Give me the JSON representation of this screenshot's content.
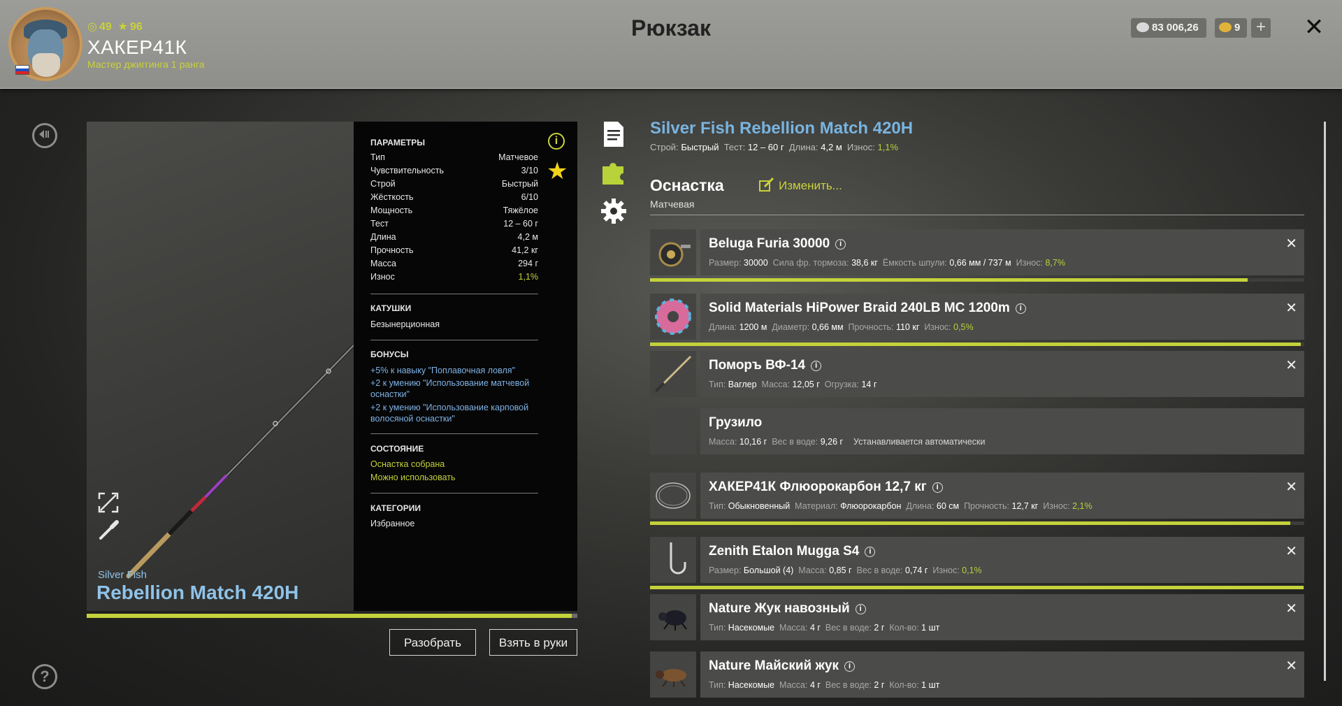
{
  "header": {
    "title": "Рюкзак",
    "player": {
      "level": "49",
      "stars": "96",
      "name": "ХАКЕР41К",
      "rank": "Мастер джиггинга 1 ранга"
    },
    "currency": {
      "silver": "83 006,26",
      "gold": "9"
    },
    "plus_label": "+",
    "close_label": "✕"
  },
  "rod": {
    "brand": "Silver Fish",
    "model": "Rebellion Match 420H",
    "wear_fraction": 0.989
  },
  "params": {
    "section_title": "ПАРАМЕТРЫ",
    "rows": [
      {
        "k": "Тип",
        "v": "Матчевое"
      },
      {
        "k": "Чувствительность",
        "v": "3/10"
      },
      {
        "k": "Строй",
        "v": "Быстрый"
      },
      {
        "k": "Жёсткость",
        "v": "6/10"
      },
      {
        "k": "Мощность",
        "v": "Тяжёлое"
      },
      {
        "k": "Тест",
        "v": "12 – 60 г"
      },
      {
        "k": "Длина",
        "v": "4,2 м"
      },
      {
        "k": "Прочность",
        "v": "41,2 кг"
      },
      {
        "k": "Масса",
        "v": "294 г"
      },
      {
        "k": "Износ",
        "v": "1,1%"
      }
    ],
    "reels_title": "КАТУШКИ",
    "reels_value": "Безынерционная",
    "bonuses_title": "БОНУСЫ",
    "bonuses": [
      "+5% к навыку \"Поплавочная ловля\"",
      "+2 к умению \"Использование матчевой оснастки\"",
      "+2 к умению \"Использование карповой волосяной оснастки\""
    ],
    "state_title": "СОСТОЯНИЕ",
    "state": [
      "Оснастка собрана",
      "Можно использовать"
    ],
    "categories_title": "КАТЕГОРИИ",
    "categories_value": "Избранное",
    "info_label": "i"
  },
  "buttons": {
    "disassemble": "Разобрать",
    "take": "Взять в руки"
  },
  "item": {
    "title": "Silver Fish Rebellion Match 420H",
    "sub": [
      {
        "k": "Строй:",
        "v": "Быстрый"
      },
      {
        "k": "Тест:",
        "v": "12 – 60 г"
      },
      {
        "k": "Длина:",
        "v": "4,2 м"
      },
      {
        "k": "Износ:",
        "v": "1,1%"
      }
    ]
  },
  "rig": {
    "title": "Оснастка",
    "type": "Матчевая",
    "change_label": "Изменить..."
  },
  "components": [
    {
      "name": "Beluga Furia 30000",
      "stats": [
        {
          "k": "Размер:",
          "v": "30000"
        },
        {
          "k": "Сила фр. тормоза:",
          "v": "38,6 кг"
        },
        {
          "k": "Ёмкость шпули:",
          "v": "0,66 мм / 737 м"
        },
        {
          "k": "Износ:",
          "v": "8,7%",
          "wear": true
        }
      ],
      "wear_fraction": 0.913
    },
    {
      "name": "Solid Materials HiPower Braid 240LB MC 1200m",
      "stats": [
        {
          "k": "Длина:",
          "v": "1200 м"
        },
        {
          "k": "Диаметр:",
          "v": "0,66 мм"
        },
        {
          "k": "Прочность:",
          "v": "110 кг"
        },
        {
          "k": "Износ:",
          "v": "0,5%",
          "wear": true
        }
      ],
      "wear_fraction": 0.995
    },
    {
      "name": "Поморъ ВФ-14",
      "stats": [
        {
          "k": "Тип:",
          "v": "Ваглер"
        },
        {
          "k": "Масса:",
          "v": "12,05 г"
        },
        {
          "k": "Огрузка:",
          "v": "14 г"
        }
      ]
    },
    {
      "name": "Грузило",
      "stats": [
        {
          "k": "Масса:",
          "v": "10,16 г"
        },
        {
          "k": "Вес в воде:",
          "v": "9,26 г"
        },
        {
          "k": "",
          "v": "Устанавливается автоматически"
        }
      ]
    },
    {
      "name": "ХАКЕР41К Флюорокарбон 12,7 кг",
      "stats": [
        {
          "k": "Тип:",
          "v": "Обыкновенный"
        },
        {
          "k": "Материал:",
          "v": "Флюорокарбон"
        },
        {
          "k": "Длина:",
          "v": "60 см"
        },
        {
          "k": "Прочность:",
          "v": "12,7 кг"
        },
        {
          "k": "Износ:",
          "v": "2,1%",
          "wear": true
        }
      ],
      "wear_fraction": 0.979
    },
    {
      "name": "Zenith Etalon Mugga S4",
      "stats": [
        {
          "k": "Размер:",
          "v": "Большой (4)"
        },
        {
          "k": "Масса:",
          "v": "0,85 г"
        },
        {
          "k": "Вес в воде:",
          "v": "0,74 г"
        },
        {
          "k": "Износ:",
          "v": "0,1%",
          "wear": true
        }
      ],
      "wear_fraction": 0.999
    },
    {
      "name": "Nature Жук навозный",
      "stats": [
        {
          "k": "Тип:",
          "v": "Насекомые"
        },
        {
          "k": "Масса:",
          "v": "4 г"
        },
        {
          "k": "Вес в воде:",
          "v": "2 г"
        },
        {
          "k": "Кол-во:",
          "v": "1 шт"
        }
      ]
    },
    {
      "name": "Nature Майский жук",
      "stats": [
        {
          "k": "Тип:",
          "v": "Насекомые"
        },
        {
          "k": "Масса:",
          "v": "4 г"
        },
        {
          "k": "Вес в воде:",
          "v": "2 г"
        },
        {
          "k": "Кол-во:",
          "v": "1 шт"
        }
      ]
    }
  ],
  "colors": {
    "accent_green": "#c4d23b",
    "title_blue": "#79b4df",
    "bonus_blue": "#7fb2e5"
  }
}
